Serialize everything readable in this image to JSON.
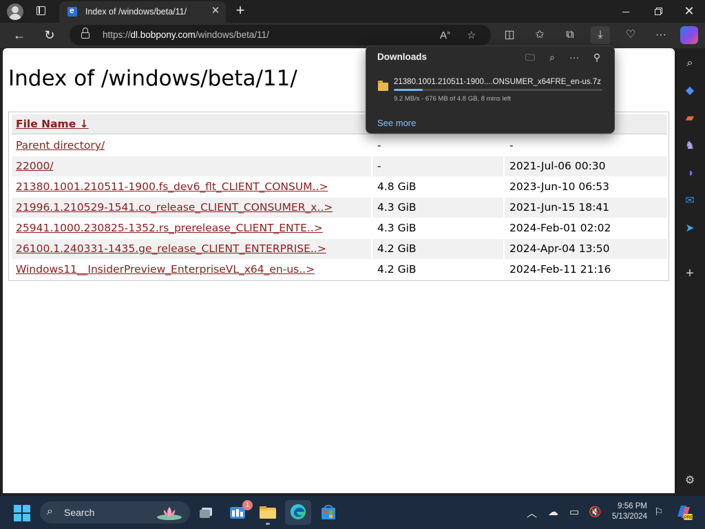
{
  "browser": {
    "tab_title": "Index of /windows/beta/11/",
    "url_scheme": "https://",
    "url_host": "dl.bobpony.com",
    "url_path": "/windows/beta/11/"
  },
  "page": {
    "heading": "Index of /windows/beta/11/",
    "columns": {
      "name": "File Name",
      "sort_indicator": "↓"
    },
    "rows": [
      {
        "name": "Parent directory/",
        "size": "-",
        "date": "-"
      },
      {
        "name": "22000/",
        "size": "-",
        "date": "2021-Jul-06 00:30"
      },
      {
        "name": "21380.1001.210511-1900.fs_dev6_flt_CLIENT_CONSUM..>",
        "size": "4.8 GiB",
        "date": "2023-Jun-10 06:53"
      },
      {
        "name": "21996.1.210529-1541.co_release_CLIENT_CONSUMER_x..>",
        "size": "4.3 GiB",
        "date": "2021-Jun-15 18:41"
      },
      {
        "name": "25941.1000.230825-1352.rs_prerelease_CLIENT_ENTE..>",
        "size": "4.3 GiB",
        "date": "2024-Feb-01 02:02"
      },
      {
        "name": "26100.1.240331-1435.ge_release_CLIENT_ENTERPRISE..>",
        "size": "4.2 GiB",
        "date": "2024-Apr-04 13:50"
      },
      {
        "name": "Windows11__InsiderPreview_EnterpriseVL_x64_en-us..>",
        "size": "4.2 GiB",
        "date": "2024-Feb-11 21:16"
      }
    ]
  },
  "downloads": {
    "title": "Downloads",
    "item_name": "21380.1001.210511-1900....ONSUMER_x64FRE_en-us.7z",
    "item_status": "9.2 MB/s - 676 MB of 4.8 GB, 8 mins left",
    "progress_percent": 14,
    "see_more": "See more"
  },
  "taskbar": {
    "search_label": "Search",
    "notification_count": "1",
    "time": "9:56 PM",
    "date": "5/13/2024"
  },
  "colors": {
    "link": "#8e1b1b",
    "progress": "#6cb8ff",
    "accent": "#4cc2ff"
  }
}
